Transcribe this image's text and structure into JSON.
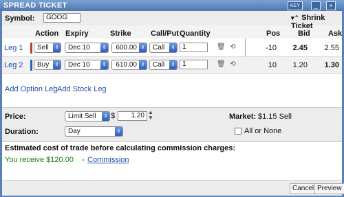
{
  "window": {
    "title": "SPREAD TICKET",
    "key_label": "KEY",
    "min_label": "_",
    "close_label": "×"
  },
  "symbol": {
    "label": "Symbol:",
    "value": "GOOG"
  },
  "shrink": {
    "icon": "chevron-double-icon",
    "label": "Shrink Ticket"
  },
  "table": {
    "columns": [
      "Action",
      "Expiry",
      "Strike",
      "Call/Put",
      "Quantity",
      "Pos",
      "Bid",
      "Ask"
    ],
    "legs": [
      {
        "label": "Leg 1",
        "action": "Sell",
        "expiry": "Dec 10",
        "strike": "600.00",
        "call_put": "Call",
        "quantity": "1",
        "pos": "-10",
        "bid": "2.45",
        "ask": "2.55",
        "bar_color": "#c03a2b"
      },
      {
        "label": "Leg 2",
        "action": "Buy",
        "expiry": "Dec 10",
        "strike": "610.00",
        "call_put": "Call",
        "quantity": "1",
        "pos": "10",
        "bid": "1.20",
        "ask": "1.30",
        "bar_color": "#2a5fbd"
      }
    ],
    "add_option_leg": "Add Option Leg",
    "add_stock_leg": "Add Stock Leg"
  },
  "order": {
    "price_label": "Price:",
    "price_type": "Limit Sell",
    "currency": "$",
    "price_value": "1.20",
    "duration_label": "Duration:",
    "duration_value": "Day",
    "market_label": "Market:",
    "market_value": "$1.15 Sell",
    "all_or_none": "All or None"
  },
  "estimate": {
    "title": "Estimated cost of trade before calculating commission charges:",
    "receive": "You receive $120.00",
    "dash": "-",
    "commission_link": "Commission"
  },
  "footer": {
    "cancel": "Cancel",
    "preview": "Preview"
  }
}
